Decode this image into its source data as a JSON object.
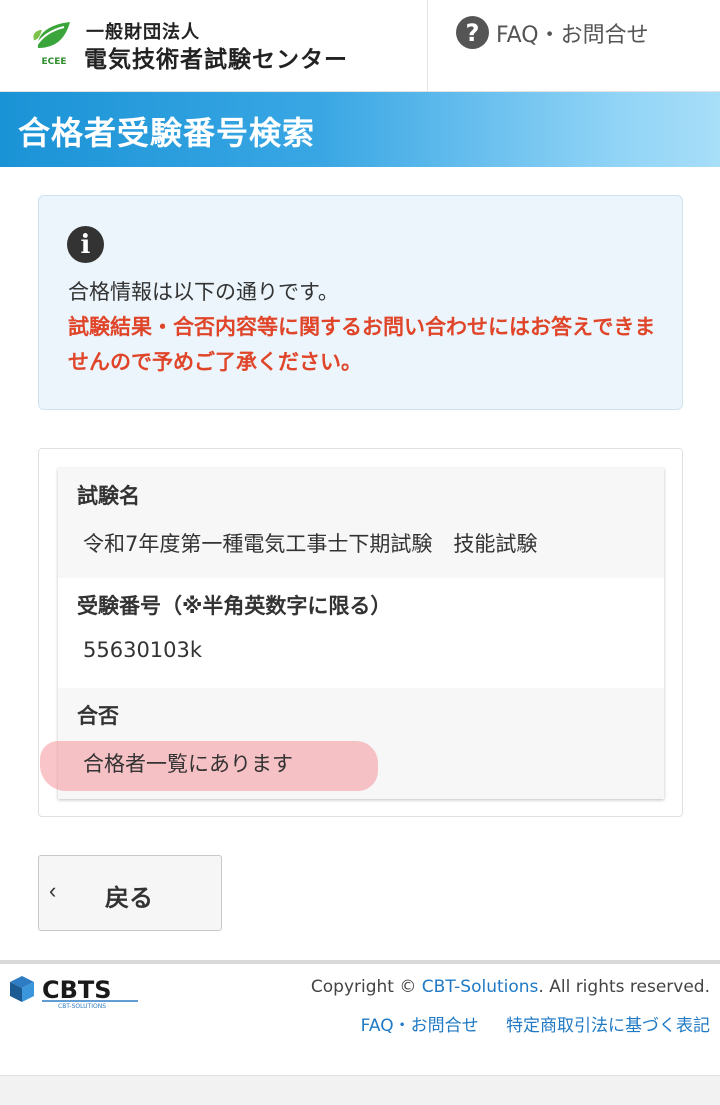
{
  "header": {
    "org_small": "一般財団法人",
    "org_name": "電気技術者試験センター",
    "logo_text": "ECEE",
    "faq_label": "FAQ・お問合せ",
    "faq_icon": "question-circle-icon"
  },
  "page_title": "合格者受験番号検索",
  "info": {
    "icon": "info-icon",
    "message": "合格情報は以下の通りです。",
    "warning": "試験結果・合否内容等に関するお問い合わせにはお答えできませんので予めご了承ください。"
  },
  "result": {
    "rows": [
      {
        "label": "試験名",
        "value": "令和7年度第一種電気工事士下期試験　技能試験"
      },
      {
        "label": "受験番号（※半角英数字に限る）",
        "value": "55630103k"
      },
      {
        "label": "合否",
        "value": "合格者一覧にあります"
      }
    ]
  },
  "back_button": {
    "label": "戻る",
    "icon": "chevron-left-icon"
  },
  "footer": {
    "logo_text": "CBTS",
    "logo_sub": "CBT-SOLUTIONS",
    "copyright_prefix": "Copyright ©",
    "copyright_link": "CBT-Solutions",
    "copyright_suffix": ". All rights reserved.",
    "links": [
      "FAQ・お問合せ",
      "特定商取引法に基づく表記"
    ]
  },
  "colors": {
    "accent_blue": "#1a93d6",
    "warning_red": "#e0452a",
    "link_blue": "#1f79c4",
    "highlight_pink": "#f4969b"
  }
}
